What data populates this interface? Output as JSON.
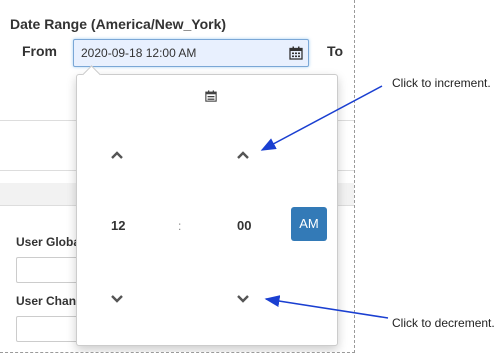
{
  "form": {
    "title": "Date Range (America/New_York)",
    "from_label": "From",
    "to_label": "To",
    "from_value": "2020-09-18 12:00 AM",
    "field1_label": "User Globa",
    "field2_label": "User Chan"
  },
  "picker": {
    "hour": "12",
    "separator": ":",
    "minute": "00",
    "meridiem": "AM",
    "accent_color": "#337ab7",
    "icons": [
      "calendar-icon",
      "chevron-up-icon",
      "chevron-down-icon"
    ]
  },
  "annotations": {
    "increment": "Click to increment.",
    "decrement": "Click to decrement.",
    "arrow_color": "#1a3fd1"
  }
}
